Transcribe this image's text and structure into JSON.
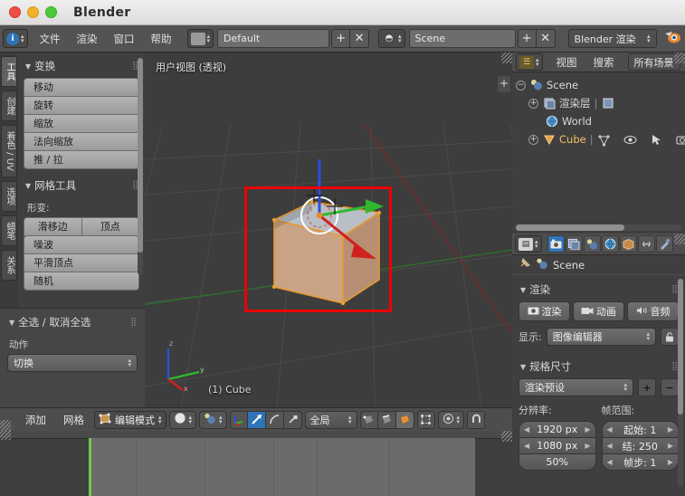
{
  "window": {
    "title": "Blender"
  },
  "topbar": {
    "menus": [
      "文件",
      "渲染",
      "窗口",
      "帮助"
    ],
    "screen_layout": "Default",
    "scene_name": "Scene",
    "render_engine": "Blender 渲染",
    "add_label": "+",
    "remove_label": "✕"
  },
  "toolshelf": {
    "tabs": [
      {
        "label": "工具",
        "active": true
      },
      {
        "label": "创建",
        "active": false
      },
      {
        "label": "着色 / UV",
        "active": false
      },
      {
        "label": "选项",
        "active": false
      },
      {
        "label": "蜡笔",
        "active": false
      },
      {
        "label": "关系",
        "active": false
      }
    ],
    "transform": {
      "title": "变换",
      "buttons": [
        "移动",
        "旋转",
        "缩放",
        "法向缩放",
        "推 / 拉"
      ]
    },
    "mesh_tools": {
      "title": "网格工具",
      "deform_label": "形变:",
      "row_buttons": [
        "滑移边",
        "顶点"
      ],
      "buttons": [
        "噪波",
        "平滑顶点",
        "随机"
      ]
    }
  },
  "redo_panel": {
    "title": "全选 / 取消全选",
    "action_label": "动作",
    "action_value": "切换"
  },
  "viewport": {
    "view_label": "用户视图 (透视)",
    "object_label": "(1) Cube",
    "axis_gizmo": {
      "z": "z",
      "y": "y",
      "x": "x"
    },
    "annotation_color": "#ee0000"
  },
  "outliner": {
    "header": {
      "view": "视图",
      "search": "搜索",
      "filter": "所有场景"
    },
    "rows": [
      {
        "name": "Scene",
        "icon": "scene-icon",
        "depth": 0
      },
      {
        "name": "渲染层",
        "icon": "render-layers-icon",
        "depth": 1
      },
      {
        "name": "World",
        "icon": "world-icon",
        "depth": 1
      },
      {
        "name": "Cube",
        "icon": "mesh-icon",
        "depth": 1
      }
    ]
  },
  "properties": {
    "tabs": [
      {
        "name": "render-tab",
        "glyph": "📷",
        "active": true
      },
      {
        "name": "render-layers-tab",
        "glyph": "🖼",
        "active": false
      },
      {
        "name": "scene-tab",
        "glyph": "◐",
        "active": false
      },
      {
        "name": "world-tab",
        "glyph": "🌐",
        "active": false
      },
      {
        "name": "object-tab",
        "glyph": "■",
        "active": false
      },
      {
        "name": "constraints-tab",
        "glyph": "🔗",
        "active": false
      },
      {
        "name": "modifiers-tab",
        "glyph": "🔧",
        "active": false
      }
    ],
    "breadcrumb": "Scene",
    "render_section": {
      "title": "渲染",
      "buttons": [
        "渲染",
        "动画",
        "音频"
      ],
      "display_label": "显示:",
      "display_value": "图像编辑器"
    },
    "dimensions_section": {
      "title": "规格尺寸",
      "preset_value": "渲染预设",
      "resolution_label": "分辨率:",
      "resolution_x": "1920 px",
      "resolution_y": "1080 px",
      "resolution_pct": "50%",
      "frame_range_label": "帧范围:",
      "frame_start": "起始:  1",
      "frame_end": "结:  250",
      "frame_step": "帧步:  1"
    }
  },
  "viewport_footer": {
    "menus": [
      "添加",
      "网格"
    ],
    "mode": "编辑模式",
    "orientation": "全局"
  }
}
